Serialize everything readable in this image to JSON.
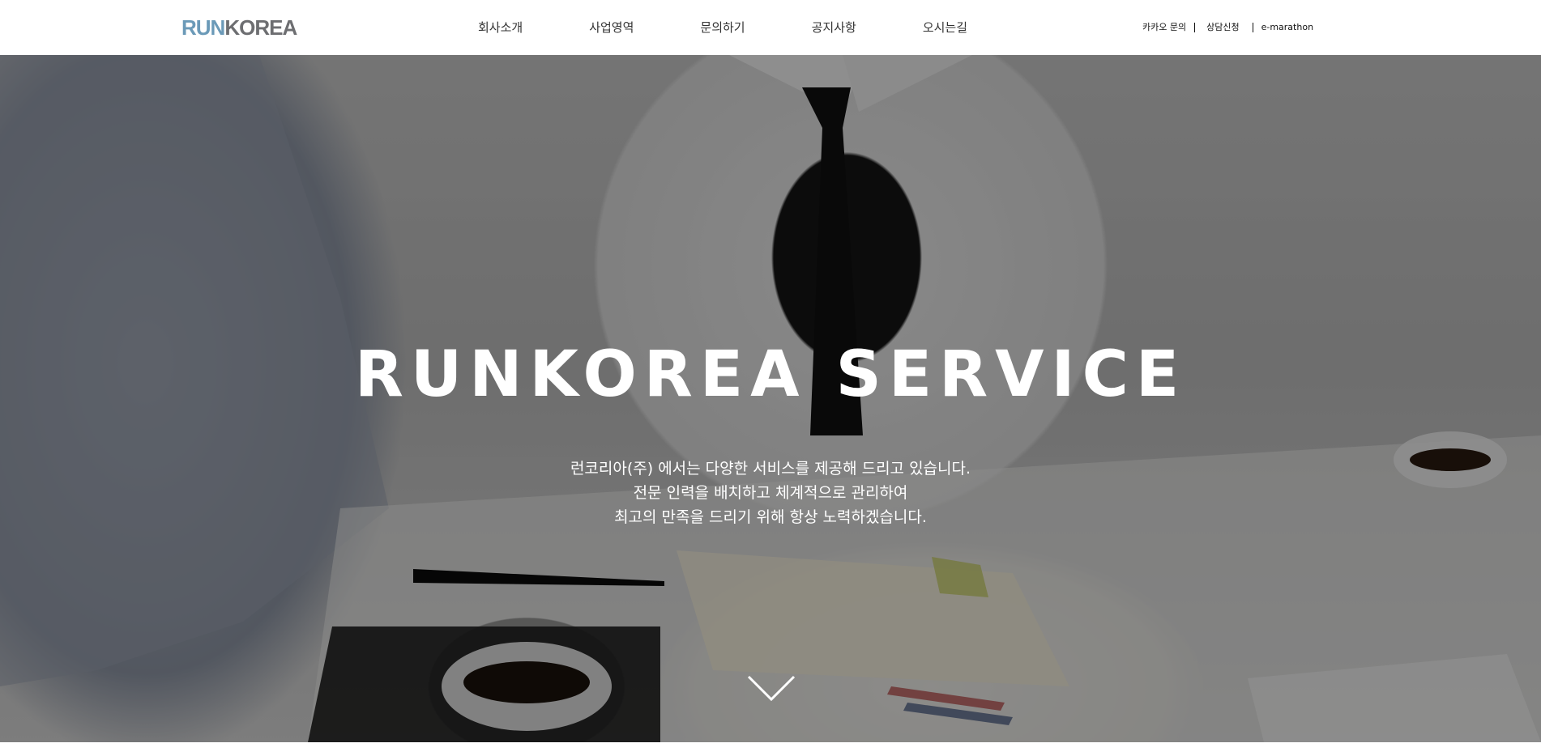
{
  "logo": {
    "part1": "RUN",
    "part2": "KOREA"
  },
  "nav": {
    "items": [
      {
        "label": "회사소개"
      },
      {
        "label": "사업영역"
      },
      {
        "label": "문의하기"
      },
      {
        "label": "공지사항"
      },
      {
        "label": "오시는길"
      }
    ]
  },
  "util": {
    "kakao": "카카오 문의",
    "consult": "상담신청",
    "emarathon": "e-marathon"
  },
  "hero": {
    "title": "RUNKOREA SERVICE",
    "lines": [
      "런코리아(주) 에서는 다양한 서비스를 제공해 드리고 있습니다.",
      "전문 인력을 배치하고 체계적으로 관리하여",
      "최고의 만족을 드리기 위해 항상 노력하겠습니다."
    ],
    "scroll_icon": "chevron-down-icon"
  },
  "colors": {
    "logo_run": "#6b9ab8",
    "logo_korea": "#6d6e71",
    "nav_text": "#333333",
    "hero_text": "#ffffff"
  }
}
